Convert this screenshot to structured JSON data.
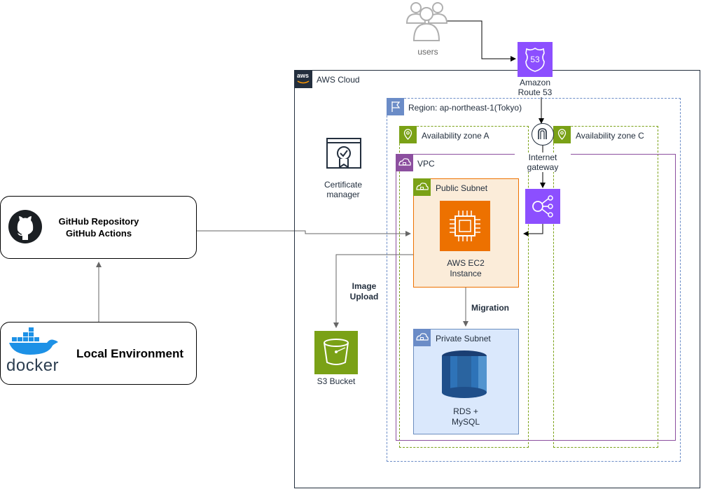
{
  "users": {
    "label": "users"
  },
  "route53": {
    "label_line1": "Amazon",
    "label_line2": "Route 53",
    "badge": "53"
  },
  "aws_cloud": {
    "label": "AWS Cloud",
    "logo_text": "aws"
  },
  "region": {
    "label": "Region: ap-northeast-1(Tokyo)"
  },
  "az_a": {
    "label": "Availability zone A"
  },
  "az_c": {
    "label": "Availability zone C"
  },
  "igw": {
    "label_line1": "Internet",
    "label_line2": "gateway"
  },
  "vpc": {
    "label": "VPC"
  },
  "public_subnet": {
    "label": "Public Subnet"
  },
  "ec2": {
    "label_line1": "AWS EC2",
    "label_line2": "Instance"
  },
  "private_subnet": {
    "label": "Private Subnet"
  },
  "rds": {
    "label_line1": "RDS +",
    "label_line2": "MySQL"
  },
  "cert": {
    "label_line1": "Certificate",
    "label_line2": "manager"
  },
  "s3": {
    "label": "S3 Bucket"
  },
  "edges": {
    "image_upload_line1": "Image",
    "image_upload_line2": "Upload",
    "migration": "Migration"
  },
  "github": {
    "line1": "GitHub Repository",
    "line2": "GitHub Actions"
  },
  "local": {
    "label": "Local Environment",
    "docker_text": "docker"
  },
  "colors": {
    "route53": "#8c4fff",
    "ec2": "#ed7100",
    "s3": "#7aa116",
    "rds": "#2e73b8",
    "region_border": "#6b8cc7",
    "az_border": "#7aa116",
    "vpc_border": "#8c4f9f",
    "public_fill": "#fbecd9",
    "private_fill": "#dae8fc"
  }
}
